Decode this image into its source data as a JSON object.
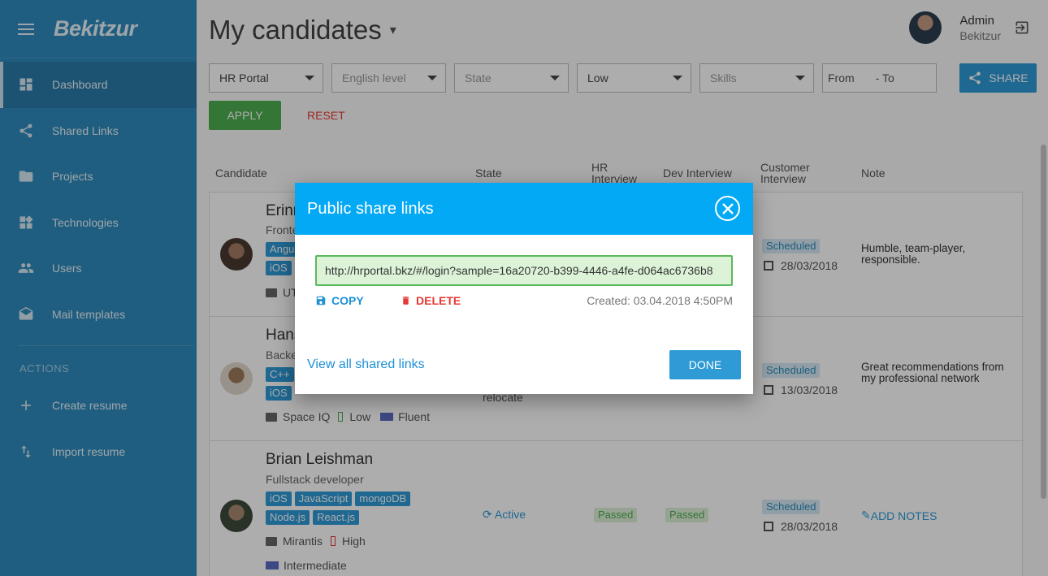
{
  "app": {
    "logo": "Bekitzur"
  },
  "sidebar": {
    "items": [
      {
        "label": "Dashboard",
        "icon": "dashboard-icon",
        "active": true
      },
      {
        "label": "Shared Links",
        "icon": "share-icon"
      },
      {
        "label": "Projects",
        "icon": "folder-icon"
      },
      {
        "label": "Technologies",
        "icon": "widgets-icon"
      },
      {
        "label": "Users",
        "icon": "users-icon"
      },
      {
        "label": "Mail templates",
        "icon": "mail-icon"
      }
    ],
    "actions_header": "ACTIONS",
    "actions": [
      {
        "label": "Create resume",
        "icon": "plus-icon"
      },
      {
        "label": "Import resume",
        "icon": "import-icon"
      }
    ]
  },
  "header": {
    "title": "My candidates",
    "user_name": "Admin",
    "user_org": "Bekitzur"
  },
  "filters": {
    "portal": "HR Portal",
    "english_level": "English level",
    "state": "State",
    "priority": "Low",
    "skills": "Skills",
    "from": "From",
    "to": "- To",
    "share_label": "SHARE",
    "apply_label": "APPLY",
    "reset_label": "RESET"
  },
  "table": {
    "columns": [
      "Candidate",
      "State",
      "HR Interview",
      "Dev Interview",
      "Customer Interview",
      "Note"
    ],
    "rows": [
      {
        "name": "Erinn",
        "role": "Fronte",
        "tags": [
          "Angu",
          "iOS"
        ],
        "company": "UT",
        "customer_status": "Scheduled",
        "customer_date": "28/03/2018",
        "note": "Humble, team-player, responsible."
      },
      {
        "name": "Hans",
        "role": "Backe",
        "tags": [
          "C++",
          "iOS"
        ],
        "company": "Space IQ",
        "priority": "Low",
        "english": "Fluent",
        "state_extra": "relocate",
        "customer_status": "Scheduled",
        "customer_date": "13/03/2018",
        "note": "Great recommendations from my professional network"
      },
      {
        "name": "Brian Leishman",
        "role": "Fullstack developer",
        "tags": [
          "iOS",
          "JavaScript",
          "mongoDB",
          "Node.js",
          "React.js"
        ],
        "company": "Mirantis",
        "priority": "High",
        "english": "Intermediate",
        "state": "Active",
        "hr_status": "Passed",
        "dev_status": "Passed",
        "customer_status": "Scheduled",
        "customer_date": "28/03/2018",
        "note_action": "ADD NOTES"
      }
    ]
  },
  "modal": {
    "title": "Public share links",
    "link": "http://hrportal.bkz/#/login?sample=16a20720-b399-4446-a4fe-d064ac6736b8",
    "copy_label": "COPY",
    "delete_label": "DELETE",
    "created": "Created: 03.04.2018 4:50PM",
    "view_all_label": "View all shared links",
    "done_label": "DONE"
  },
  "colors": {
    "sidebar": "#2e8bbd",
    "modal_header": "#03a9f4",
    "apply": "#4caf50",
    "reset": "#e53935",
    "link_bg": "#dcf3d8"
  }
}
